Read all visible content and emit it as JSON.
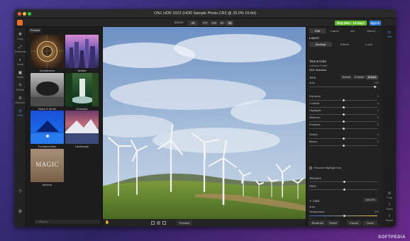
{
  "window": {
    "title": "ON1 HDR 2022 (HDR Sample Photo.CR2 @ 25.0% 16-bit)"
  },
  "toolbar": {
    "app_label": "ON1 HDR 2022",
    "zoom_label": "Zoom:",
    "zoom_value": "25",
    "zoom_options": [
      "FIT",
      "100",
      "50",
      "25"
    ],
    "buy_label": "Buy Now - 13 Days Left",
    "signin_label": "Sign In"
  },
  "tools": [
    {
      "icon": "✥",
      "label": "Crop"
    },
    {
      "icon": "⤢",
      "label": "Transform"
    },
    {
      "icon": "◐",
      "label": "Local"
    },
    {
      "icon": "▣",
      "label": "Mask"
    },
    {
      "icon": "✎",
      "label": "Refine"
    },
    {
      "icon": "⊘",
      "label": "Retouch"
    },
    {
      "icon": "◎",
      "label": "View"
    }
  ],
  "presets": {
    "tab": "Presets",
    "items": [
      {
        "label": "Architecture"
      },
      {
        "label": "Artistic"
      },
      {
        "label": "Black & White"
      },
      {
        "label": "Dramatic"
      },
      {
        "label": "Fundamentals"
      },
      {
        "label": "Landscape"
      },
      {
        "label": "Modern"
      }
    ],
    "modern_thumb_text": "MAGIC",
    "search_placeholder": "Search"
  },
  "bottombar": {
    "preview_label": "Preview"
  },
  "panel": {
    "tabs": [
      "Edit",
      "Layers",
      "Info",
      "History"
    ],
    "active_tab": "Edit",
    "layers_label": "Layers",
    "subtabs": [
      "Develop",
      "Effects",
      "Local"
    ],
    "tone_color_label": "Tone & Color",
    "camera_profile_label": "Camera Profile:",
    "camera_profile_value": "ON1 Standard",
    "tone_label": "Tone",
    "tone_buttons": [
      "Normal",
      "AI Match",
      "AI Auto"
    ],
    "sliders": [
      {
        "label": "Auto",
        "value": "100",
        "pos": 0.98
      },
      {
        "label": "Exposure",
        "value": "0",
        "pos": 0.5
      },
      {
        "label": "Contrast",
        "value": "0",
        "pos": 0.5
      },
      {
        "label": "Highlights",
        "value": "0",
        "pos": 0.5
      },
      {
        "label": "Midtones",
        "value": "0",
        "pos": 0.5
      },
      {
        "label": "Shadows",
        "value": "0",
        "pos": 0.5
      },
      {
        "label": "Whites",
        "value": "0",
        "pos": 0.5
      },
      {
        "label": "Blacks",
        "value": "0",
        "pos": 0.5
      }
    ],
    "recover_highlights_label": "Recover Highlight Hue",
    "structure_label": "Structure",
    "haze_label": "Haze",
    "color_label": "Color",
    "auto_label": "Auto",
    "auto_on_label": "Auto On",
    "temperature_label": "Temperature",
    "temperature_value": "5/S",
    "tint_label": "Tint",
    "buttons": [
      "Reset All",
      "Reset",
      "Cancel",
      "Done"
    ]
  },
  "farrail": {
    "top_label": "Edit",
    "items": [
      "Crop",
      "Share",
      "Export"
    ]
  },
  "watermark": "SOFTPEDIA",
  "colors": {
    "buy": "#5fb82a",
    "signin": "#2f7ad0",
    "accent": "#3d8ee6"
  }
}
